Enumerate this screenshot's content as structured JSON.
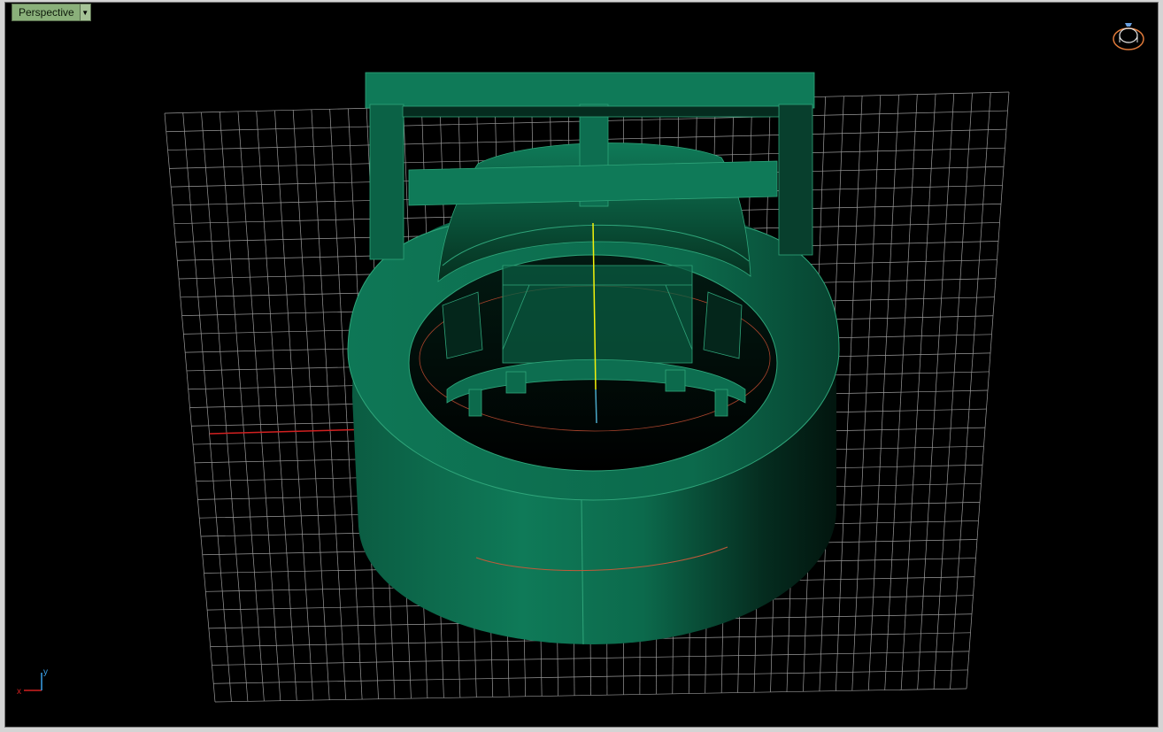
{
  "viewport": {
    "label": "Perspective",
    "dropdown_icon": "triangle-down-icon",
    "background": "#000000"
  },
  "scene": {
    "grid_color": "#9a9a9a",
    "model_color": "#0f7a58",
    "model_edge_color": "#3fbf8a",
    "x_axis_color": "#d22020",
    "y_axis_color": "#f2f20a",
    "z_axis_color": "#4aa8c8"
  },
  "gizmos": {
    "viewcube": "viewcube-icon",
    "axis_tripod": "axis-tripod-icon",
    "x_label": "x",
    "y_label": "y"
  }
}
